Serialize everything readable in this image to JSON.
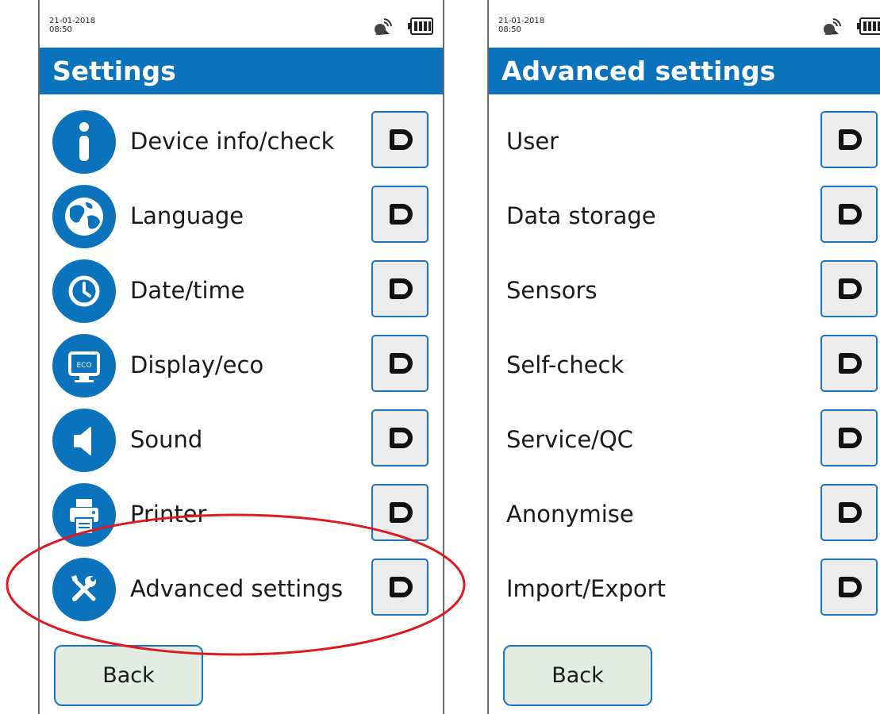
{
  "screens": [
    {
      "status": {
        "date": "21-01-2018",
        "time": "08:50"
      },
      "title": "Settings",
      "items": [
        {
          "label": "Device info/check",
          "icon": "info-icon"
        },
        {
          "label": "Language",
          "icon": "globe-icon"
        },
        {
          "label": "Date/time",
          "icon": "clock-icon"
        },
        {
          "label": "Display/eco",
          "icon": "monitor-eco-icon"
        },
        {
          "label": "Sound",
          "icon": "speaker-icon"
        },
        {
          "label": "Printer",
          "icon": "printer-icon"
        },
        {
          "label": "Advanced settings",
          "icon": "tools-icon"
        }
      ],
      "back_label": "Back"
    },
    {
      "status": {
        "date": "21-01-2018",
        "time": "08:50"
      },
      "title": "Advanced settings",
      "items": [
        {
          "label": "User"
        },
        {
          "label": "Data storage"
        },
        {
          "label": "Sensors"
        },
        {
          "label": "Self-check"
        },
        {
          "label": "Service/QC"
        },
        {
          "label": "Anonymise"
        },
        {
          "label": "Import/Export"
        }
      ],
      "back_label": "Back"
    }
  ],
  "annotation": {
    "highlighted_item": "Advanced settings",
    "color": "#e0191f"
  },
  "colors": {
    "header": "#0a73bc",
    "button_border": "#1b74c0",
    "arrow_button_bg": "#ececec",
    "back_button_bg": "#e2ece3"
  }
}
